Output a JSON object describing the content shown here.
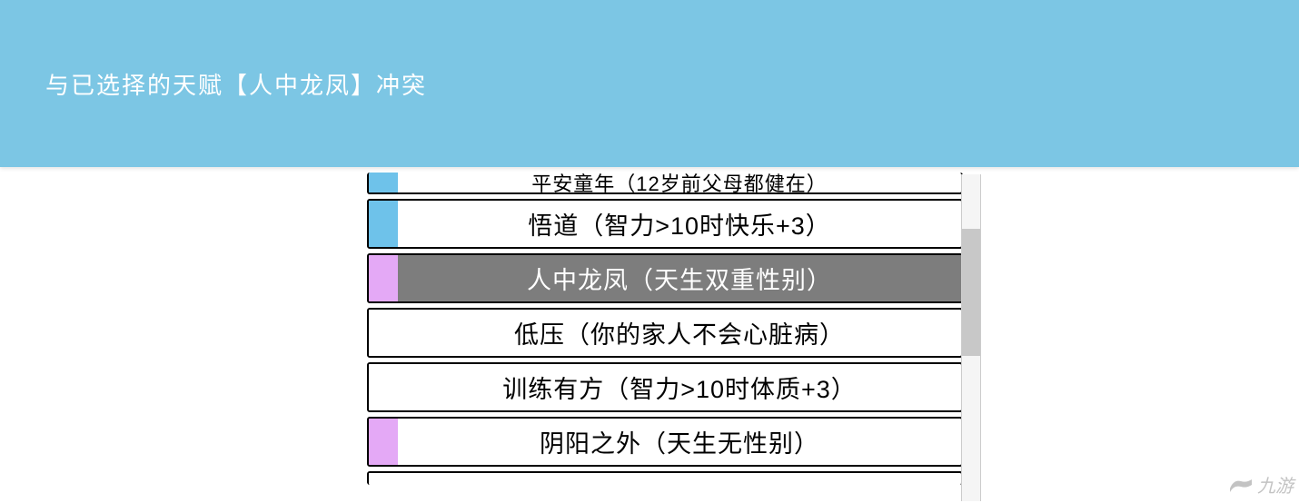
{
  "banner": {
    "message": "与已选择的天赋【人中龙凤】冲突"
  },
  "talents": [
    {
      "id": 0,
      "tag": "blue",
      "label": "平安童年（12岁前父母都健在）",
      "selected": false,
      "partial": "top"
    },
    {
      "id": 1,
      "tag": "blue",
      "label": "悟道（智力>10时快乐+3）",
      "selected": false
    },
    {
      "id": 2,
      "tag": "purple",
      "label": "人中龙凤（天生双重性别）",
      "selected": true
    },
    {
      "id": 3,
      "tag": "white",
      "label": "低压（你的家人不会心脏病）",
      "selected": false
    },
    {
      "id": 4,
      "tag": "white",
      "label": "训练有方（智力>10时体质+3）",
      "selected": false
    },
    {
      "id": 5,
      "tag": "purple",
      "label": "阴阳之外（天生无性别）",
      "selected": false
    },
    {
      "id": 6,
      "tag": "white",
      "label": "",
      "selected": false,
      "partial": "bottom"
    }
  ],
  "watermark": {
    "text": "九游"
  }
}
